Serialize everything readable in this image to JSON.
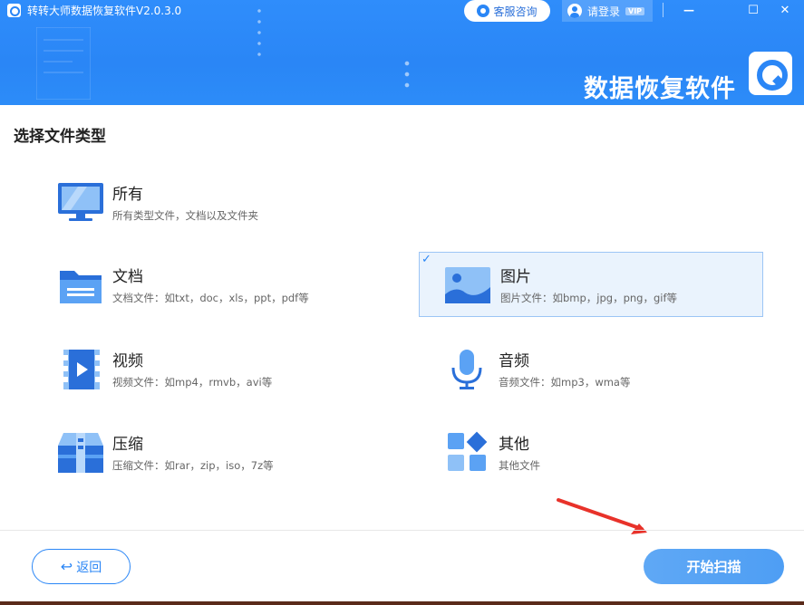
{
  "window": {
    "title": "转转大师数据恢复软件V2.0.3.0",
    "service_label": "客服咨询",
    "login_label": "请登录",
    "vip_badge": "VIP",
    "minimize": "—",
    "maximize": "☐",
    "close": "✕",
    "brand_text": "数据恢复软件"
  },
  "section": {
    "title": "选择文件类型"
  },
  "options": [
    {
      "name": "所有",
      "desc": "所有类型文件，文档以及文件夹",
      "selected": false
    },
    {
      "name": "文档",
      "desc": "文档文件：如txt，doc，xls，ppt，pdf等",
      "selected": false
    },
    {
      "name": "图片",
      "desc": "图片文件：如bmp，jpg，png，gif等",
      "selected": true
    },
    {
      "name": "视频",
      "desc": "视频文件：如mp4，rmvb，avi等",
      "selected": false
    },
    {
      "name": "音频",
      "desc": "音频文件：如mp3，wma等",
      "selected": false
    },
    {
      "name": "压缩",
      "desc": "压缩文件：如rar，zip，iso，7z等",
      "selected": false
    },
    {
      "name": "其他",
      "desc": "其他文件",
      "selected": false
    }
  ],
  "checkmark": "✓",
  "footer": {
    "back_icon": "↩",
    "back_label": "返回",
    "scan_label": "开始扫描"
  },
  "colors": {
    "accent": "#2a86f6",
    "header": "#2c8cf8",
    "selected_bg": "#eaf3fd",
    "annotation_arrow": "#e8322a"
  }
}
